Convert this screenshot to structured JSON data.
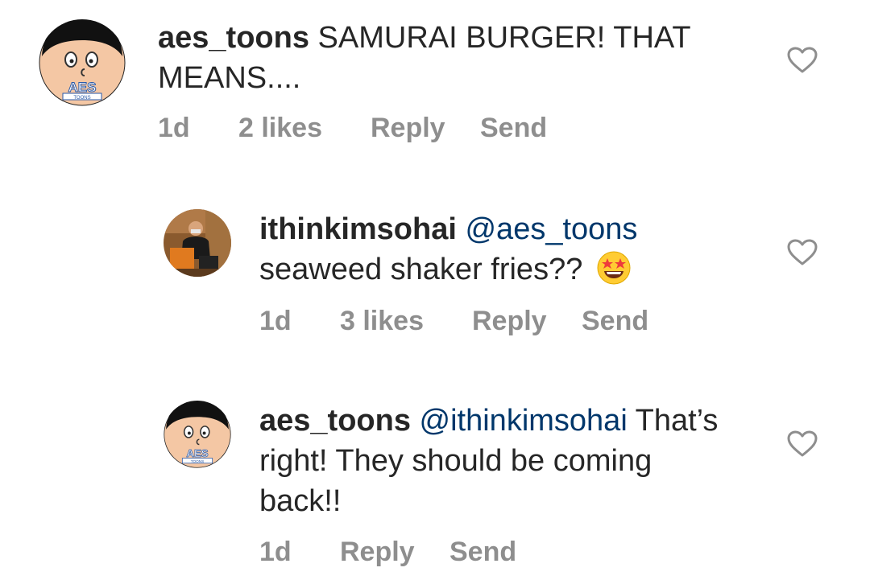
{
  "comments": [
    {
      "username": "aes_toons",
      "mention": "",
      "text": "SAMURAI BURGER! THAT MEANS....",
      "time": "1d",
      "likes": "2 likes",
      "reply_label": "Reply",
      "send_label": "Send",
      "avatar_logo": "AES",
      "avatar_sub": "TOONS"
    },
    {
      "username": "ithinkimsohai",
      "mention": "@aes_toons",
      "text": "seaweed shaker fries??",
      "emoji": "star-struck-emoji",
      "time": "1d",
      "likes": "3 likes",
      "reply_label": "Reply",
      "send_label": "Send"
    },
    {
      "username": "aes_toons",
      "mention": "@ithinkimsohai",
      "text_line1": "That’s",
      "text_line2": "right! They should be coming",
      "text_line3": "back!!",
      "time": "1d",
      "reply_label": "Reply",
      "send_label": "Send",
      "avatar_logo": "AES",
      "avatar_sub": "TOONS"
    }
  ],
  "colors": {
    "text": "#262626",
    "secondary": "#8e8e8e",
    "mention": "#00376b",
    "avatar_bg": "#f4c7a4"
  },
  "icons": {
    "like": "heart-outline-icon"
  }
}
